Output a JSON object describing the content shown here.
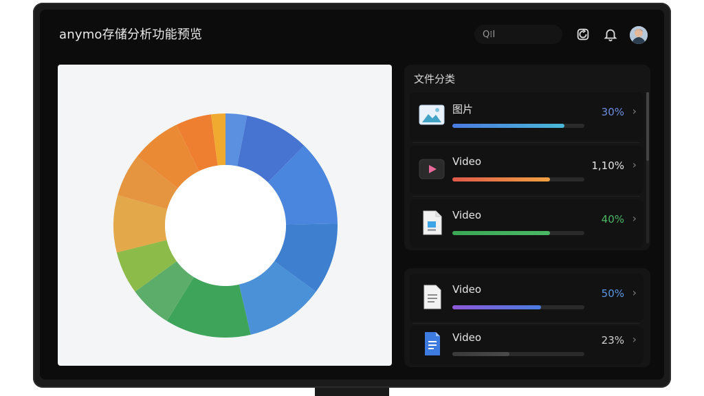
{
  "app": {
    "title": "anymo存储分析功能预览"
  },
  "header": {
    "search_text": "Q⁞I",
    "icons": [
      "refresh-icon",
      "bell-icon",
      "avatar"
    ]
  },
  "categories": {
    "title": "文件分类",
    "items": [
      {
        "label": "图片",
        "percent_text": "30%",
        "progress": 0.85,
        "color": "#4a7be0",
        "color2": "#49b8d7",
        "icon": "image-icon",
        "pct_color": "#6c8de0"
      },
      {
        "label": "Video",
        "percent_text": "1,10%",
        "progress": 0.74,
        "color": "#e05a4a",
        "color2": "#f0a142",
        "icon": "video-icon",
        "pct_color": "#e6e6e6"
      },
      {
        "label": "Video",
        "percent_text": "40%",
        "progress": 0.74,
        "color": "#3aa755",
        "color2": "#4bb866",
        "icon": "file-icon",
        "pct_color": "#4bb866"
      }
    ]
  },
  "more": {
    "items": [
      {
        "label": "Video",
        "percent_text": "50%",
        "progress": 0.67,
        "color": "#8d59d8",
        "color2": "#4a7be0",
        "icon": "document-icon",
        "pct_color": "#5a97e6"
      },
      {
        "label": "Video",
        "percent_text": "23%",
        "progress": 0.43,
        "color": "#3a3a3a",
        "color2": "#4a4a4a",
        "icon": "blue-doc-icon",
        "pct_color": "#d0d0d0"
      }
    ]
  },
  "chart_data": {
    "type": "pie",
    "title": "",
    "donut": true,
    "slices": [
      {
        "value": 3.0,
        "color": "#5b8fe0"
      },
      {
        "value": 9.0,
        "color": "#4774d0"
      },
      {
        "value": 12.0,
        "color": "#4a86dd"
      },
      {
        "value": 10.0,
        "color": "#3f7fd0"
      },
      {
        "value": 11.0,
        "color": "#4a91d8"
      },
      {
        "value": 12.0,
        "color": "#3ea45a"
      },
      {
        "value": 6.0,
        "color": "#5dad6a"
      },
      {
        "value": 6.0,
        "color": "#8dbb4a"
      },
      {
        "value": 8.0,
        "color": "#e3a84a"
      },
      {
        "value": 6.0,
        "color": "#e59440"
      },
      {
        "value": 7.0,
        "color": "#ea8a35"
      },
      {
        "value": 5.0,
        "color": "#ee7f30"
      },
      {
        "value": 2.0,
        "color": "#f0aa30"
      }
    ]
  }
}
